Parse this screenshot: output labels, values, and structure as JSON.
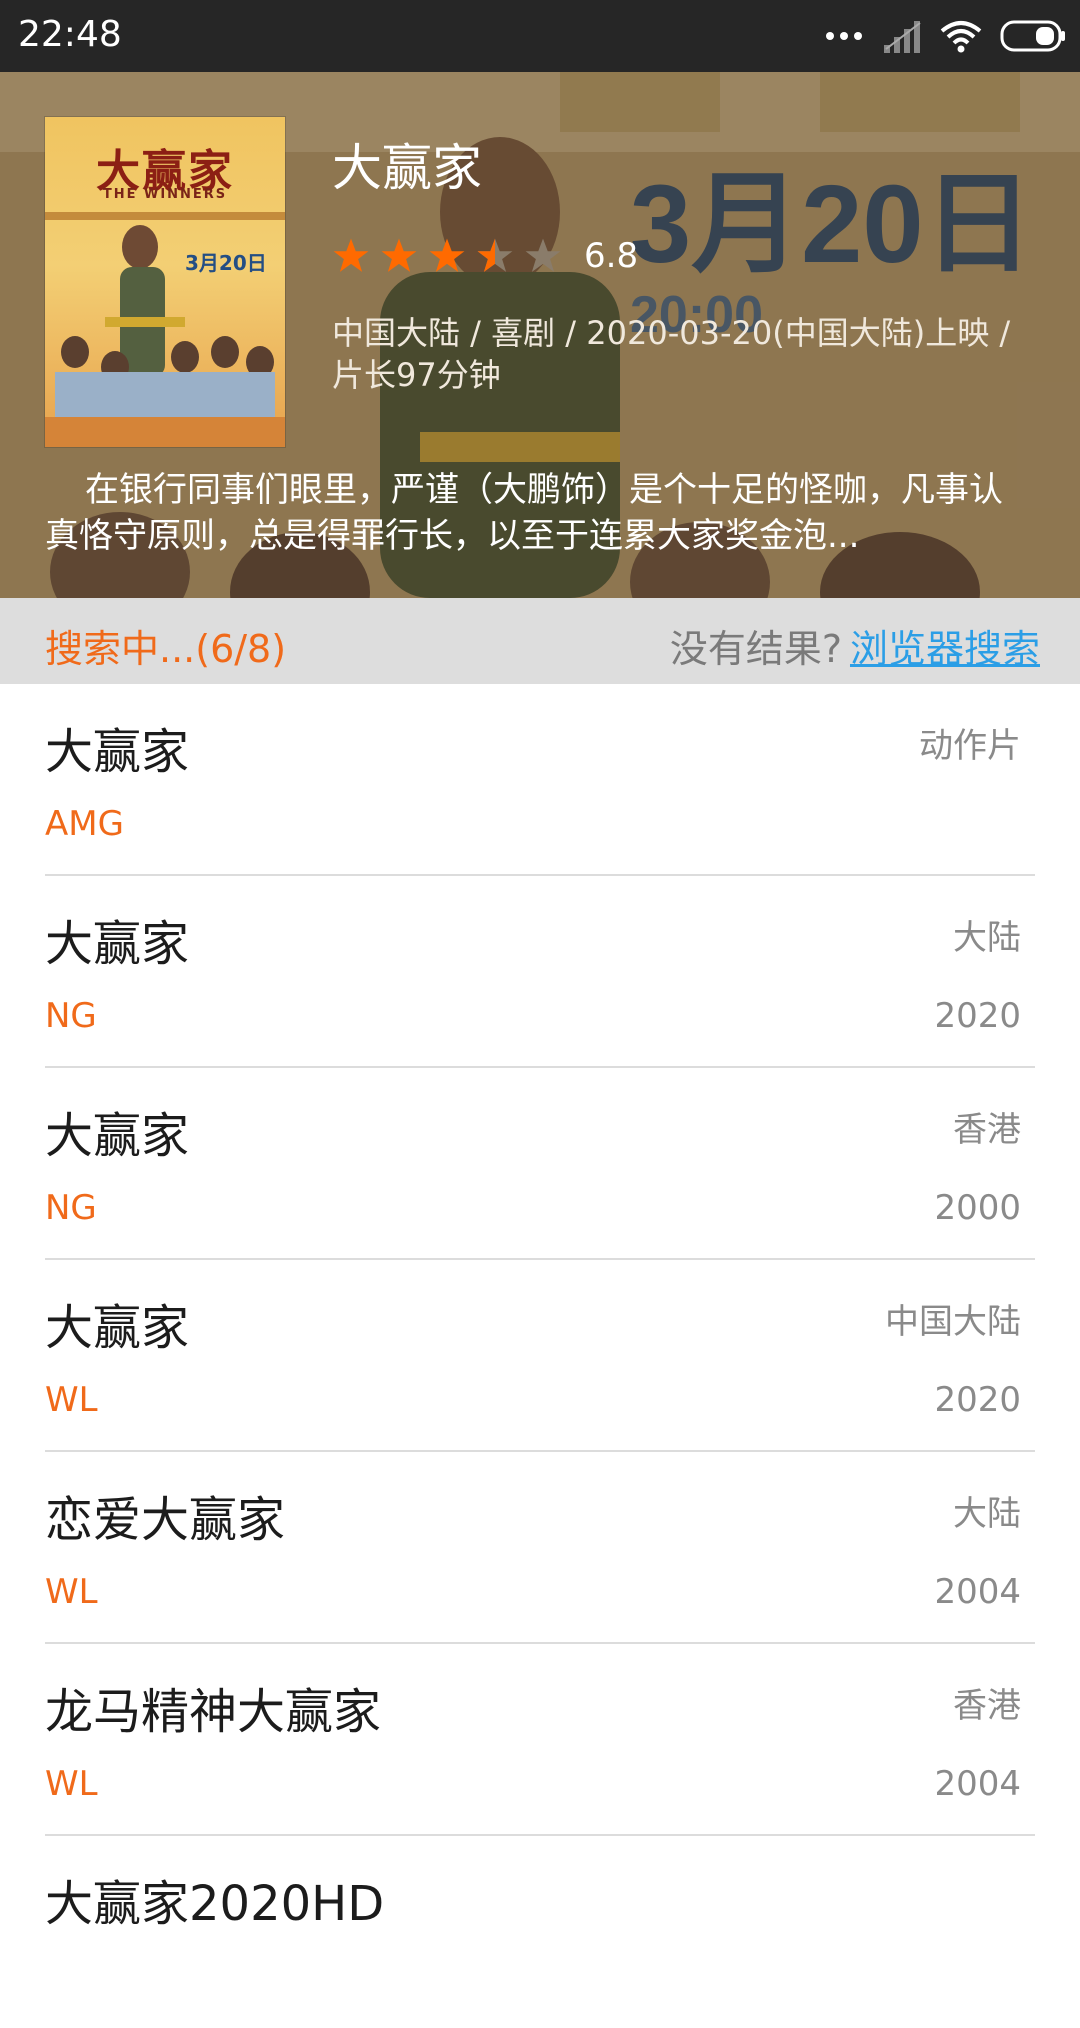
{
  "status_bar": {
    "time": "22:48",
    "icons": [
      "more-dots-icon",
      "signal-icon",
      "wifi-icon",
      "battery-icon"
    ]
  },
  "movie": {
    "title": "大赢家",
    "rating": "6.8",
    "rating_stars_of_5": 3.4,
    "meta": "中国大陆 / 喜剧 / 2020-03-20(中国大陆)上映 / 片长97分钟",
    "description": "在银行同事们眼里，严谨（大鹏饰）是个十足的怪咖，凡事认真恪守原则，总是得罪行长，以至于连累大家奖金泡...",
    "poster": {
      "title": "大赢家",
      "subtitle": "THE WINNERS",
      "date": "3月20日"
    }
  },
  "search": {
    "status": "搜索中...(6/8)",
    "no_result_prefix": "没有结果?",
    "browser_search_link": "浏览器搜索"
  },
  "results": [
    {
      "title": "大赢家",
      "region": "动作片",
      "source": "AMG",
      "year": ""
    },
    {
      "title": "大赢家",
      "region": "大陆",
      "source": "NG",
      "year": "2020"
    },
    {
      "title": "大赢家",
      "region": "香港",
      "source": "NG",
      "year": "2000"
    },
    {
      "title": "大赢家",
      "region": "中国大陆",
      "source": "WL",
      "year": "2020"
    },
    {
      "title": "恋爱大赢家",
      "region": "大陆",
      "source": "WL",
      "year": "2004"
    },
    {
      "title": "龙马精神大赢家",
      "region": "香港",
      "source": "WL",
      "year": "2004"
    },
    {
      "title": "大赢家2020HD",
      "region": "",
      "source": "",
      "year": ""
    }
  ],
  "colors": {
    "accent": "#f06a1a",
    "link": "#2b9ee6",
    "status_bar": "#262626",
    "search_bar": "#dddddd"
  }
}
